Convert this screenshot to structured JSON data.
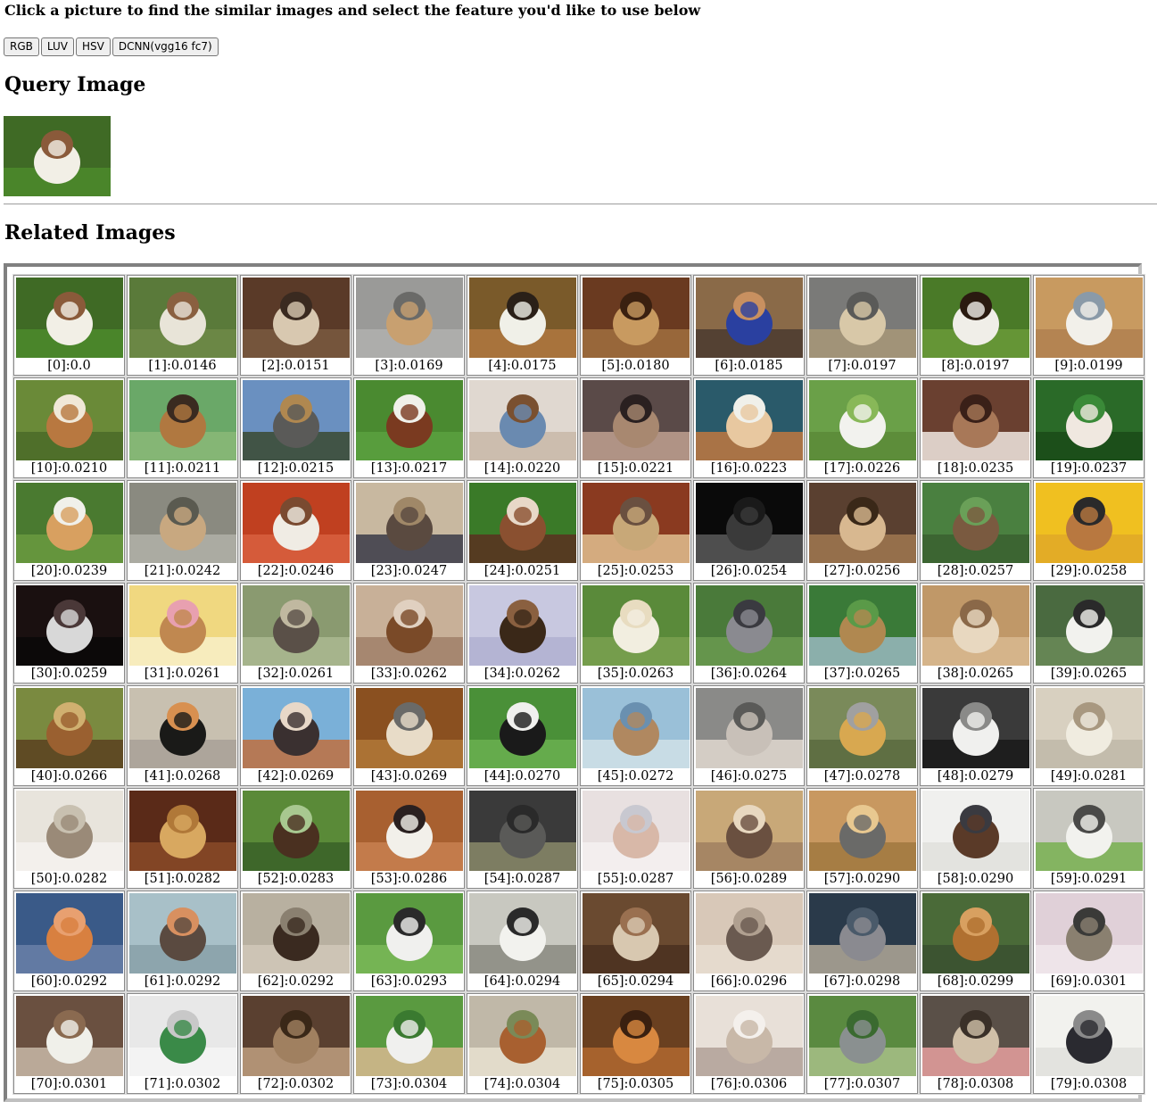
{
  "instructions": "Click a picture to find the similar images and select the feature you'd like to use below",
  "features": [
    "RGB",
    "LUV",
    "HSV",
    "DCNN(vgg16 fc7)"
  ],
  "query_heading": "Query Image",
  "related_heading": "Related Images",
  "query_image": {
    "colors": [
      "#3f6a25",
      "#f2efe6",
      "#8a5a3a",
      "#4c8a2c"
    ]
  },
  "results": [
    {
      "caption": "[0]:0.0",
      "colors": [
        "#3f6a25",
        "#f2efe6",
        "#8a5a3a",
        "#4c8a2c"
      ]
    },
    {
      "caption": "[1]:0.0146",
      "colors": [
        "#5a7a3a",
        "#e8e4d8",
        "#8a6040",
        "#6e8a48"
      ]
    },
    {
      "caption": "[2]:0.0151",
      "colors": [
        "#5a3a28",
        "#d8c8b0",
        "#3a2a20",
        "#7a5a40"
      ]
    },
    {
      "caption": "[3]:0.0169",
      "colors": [
        "#9a9a98",
        "#c8a070",
        "#6a6a68",
        "#b0b0ae"
      ]
    },
    {
      "caption": "[4]:0.0175",
      "colors": [
        "#7a5a2a",
        "#f0f0e8",
        "#2a2018",
        "#b07840"
      ]
    },
    {
      "caption": "[5]:0.0180",
      "colors": [
        "#6a3a20",
        "#c89a60",
        "#3a2010",
        "#a07040"
      ]
    },
    {
      "caption": "[6]:0.0185",
      "colors": [
        "#8a6a48",
        "#2a40a0",
        "#c89060",
        "#4a3a30"
      ]
    },
    {
      "caption": "[7]:0.0197",
      "colors": [
        "#7a7a78",
        "#d8c8a8",
        "#5a5a58",
        "#a89878"
      ]
    },
    {
      "caption": "[8]:0.0197",
      "colors": [
        "#4a7a28",
        "#f0eee8",
        "#2a1a10",
        "#6a9a38"
      ]
    },
    {
      "caption": "[9]:0.0199",
      "colors": [
        "#c89a60",
        "#f2f0ea",
        "#8a9aa8",
        "#b08050"
      ]
    },
    {
      "caption": "[10]:0.0210",
      "colors": [
        "#6a8a38",
        "#b87840",
        "#f0e8d8",
        "#4a6a28"
      ]
    },
    {
      "caption": "[11]:0.0211",
      "colors": [
        "#6aa868",
        "#b07840",
        "#3a2a20",
        "#8ab878"
      ]
    },
    {
      "caption": "[12]:0.0215",
      "colors": [
        "#6a90c0",
        "#5a5a58",
        "#b08850",
        "#3a4a30"
      ]
    },
    {
      "caption": "[13]:0.0217",
      "colors": [
        "#4a8a30",
        "#7a3a20",
        "#f0f0ea",
        "#5aa040"
      ]
    },
    {
      "caption": "[14]:0.0220",
      "colors": [
        "#e0d8d0",
        "#6a8ab0",
        "#7a5030",
        "#c8b8a8"
      ]
    },
    {
      "caption": "[15]:0.0221",
      "colors": [
        "#5a4a48",
        "#a88870",
        "#2a2020",
        "#c0a090"
      ]
    },
    {
      "caption": "[16]:0.0223",
      "colors": [
        "#2a5a6a",
        "#e8c8a0",
        "#f0f0ea",
        "#c07840"
      ]
    },
    {
      "caption": "[17]:0.0226",
      "colors": [
        "#6aa048",
        "#f2f2ee",
        "#88b858",
        "#5a8a38"
      ]
    },
    {
      "caption": "[18]:0.0235",
      "colors": [
        "#6a4030",
        "#a87858",
        "#3a2018",
        "#f0e8e0"
      ]
    },
    {
      "caption": "[19]:0.0237",
      "colors": [
        "#2a6a28",
        "#f0e8e0",
        "#3a8a38",
        "#1a4a18"
      ]
    },
    {
      "caption": "[20]:0.0239",
      "colors": [
        "#4a7a30",
        "#d8a060",
        "#f0f0ea",
        "#6a9a40"
      ]
    },
    {
      "caption": "[21]:0.0242",
      "colors": [
        "#8a8a80",
        "#c8a880",
        "#5a5a50",
        "#b0b0a8"
      ]
    },
    {
      "caption": "[22]:0.0246",
      "colors": [
        "#c04020",
        "#f0ece4",
        "#7a4a30",
        "#d86040"
      ]
    },
    {
      "caption": "[23]:0.0247",
      "colors": [
        "#c8b8a0",
        "#5a4a40",
        "#a08868",
        "#3a3a48"
      ]
    },
    {
      "caption": "[24]:0.0251",
      "colors": [
        "#3a7a28",
        "#8a5030",
        "#e8d8c8",
        "#5a3020"
      ]
    },
    {
      "caption": "[25]:0.0253",
      "colors": [
        "#8a3a20",
        "#c8a878",
        "#6a5040",
        "#e0c090"
      ]
    },
    {
      "caption": "[26]:0.0254",
      "colors": [
        "#0a0a0a",
        "#3a3a3a",
        "#1a1a1a",
        "#5a5a5a"
      ]
    },
    {
      "caption": "[27]:0.0256",
      "colors": [
        "#5a4030",
        "#d8b890",
        "#3a2818",
        "#a07850"
      ]
    },
    {
      "caption": "[28]:0.0257",
      "colors": [
        "#4a8040",
        "#7a5a40",
        "#6aa058",
        "#3a6030"
      ]
    },
    {
      "caption": "[29]:0.0258",
      "colors": [
        "#f0c020",
        "#b87840",
        "#2a2a2a",
        "#e0a828"
      ]
    },
    {
      "caption": "[30]:0.0259",
      "colors": [
        "#1a1010",
        "#d8d8d8",
        "#4a3838",
        "#0a0808"
      ]
    },
    {
      "caption": "[31]:0.0261",
      "colors": [
        "#f0d880",
        "#c08850",
        "#e8a0b0",
        "#f8f0c8"
      ]
    },
    {
      "caption": "[32]:0.0261",
      "colors": [
        "#8a9a70",
        "#5a5048",
        "#c0b8a0",
        "#aab890"
      ]
    },
    {
      "caption": "[33]:0.0262",
      "colors": [
        "#c8b098",
        "#7a4a28",
        "#e0d0c0",
        "#a08068"
      ]
    },
    {
      "caption": "[34]:0.0262",
      "colors": [
        "#c8c8e0",
        "#3a2818",
        "#8a6040",
        "#b0b0d0"
      ]
    },
    {
      "caption": "[35]:0.0263",
      "colors": [
        "#5a8a3a",
        "#f2eee0",
        "#e8dcc0",
        "#7aa050"
      ]
    },
    {
      "caption": "[36]:0.0264",
      "colors": [
        "#4a7a3a",
        "#8a8a90",
        "#3a3a40",
        "#6a9a50"
      ]
    },
    {
      "caption": "[37]:0.0265",
      "colors": [
        "#3a7a38",
        "#b08850",
        "#5a9a48",
        "#9ab8c0"
      ]
    },
    {
      "caption": "[38]:0.0265",
      "colors": [
        "#c09868",
        "#e8d8c0",
        "#8a6848",
        "#d8b890"
      ]
    },
    {
      "caption": "[39]:0.0265",
      "colors": [
        "#4a6a40",
        "#f2f2ee",
        "#2a2a2a",
        "#6a8a58"
      ]
    },
    {
      "caption": "[40]:0.0266",
      "colors": [
        "#7a8a40",
        "#9a6030",
        "#d0b070",
        "#5a4020"
      ]
    },
    {
      "caption": "[41]:0.0268",
      "colors": [
        "#c8c0b0",
        "#1a1a18",
        "#d89050",
        "#a8a098"
      ]
    },
    {
      "caption": "[42]:0.0269",
      "colors": [
        "#7ab0d8",
        "#3a3030",
        "#e8d8c8",
        "#c07040"
      ]
    },
    {
      "caption": "[43]:0.0269",
      "colors": [
        "#8a5020",
        "#e8dcc8",
        "#6a6a68",
        "#b07838"
      ]
    },
    {
      "caption": "[44]:0.0270",
      "colors": [
        "#4a9038",
        "#1a1a1a",
        "#f0f0ee",
        "#6ab050"
      ]
    },
    {
      "caption": "[45]:0.0272",
      "colors": [
        "#9ac0d8",
        "#b08860",
        "#6a90b0",
        "#d0e0e8"
      ]
    },
    {
      "caption": "[46]:0.0275",
      "colors": [
        "#8a8a88",
        "#c8c0b8",
        "#5a5a58",
        "#e0d8d0"
      ]
    },
    {
      "caption": "[47]:0.0278",
      "colors": [
        "#7a8a5a",
        "#d8a850",
        "#a0a0a0",
        "#5a6a40"
      ]
    },
    {
      "caption": "[48]:0.0279",
      "colors": [
        "#3a3a3a",
        "#f0f0ee",
        "#8a8a88",
        "#1a1a1a"
      ]
    },
    {
      "caption": "[49]:0.0281",
      "colors": [
        "#d8d0c0",
        "#f0ece0",
        "#a89880",
        "#c0b8a8"
      ]
    },
    {
      "caption": "[50]:0.0282",
      "colors": [
        "#e8e4dc",
        "#9a8a78",
        "#c8c0b0",
        "#f4f2ee"
      ]
    },
    {
      "caption": "[51]:0.0282",
      "colors": [
        "#5a2a18",
        "#d8a860",
        "#b07838",
        "#8a4a28"
      ]
    },
    {
      "caption": "[52]:0.0283",
      "colors": [
        "#5a8a38",
        "#4a3020",
        "#a8c890",
        "#3a6028"
      ]
    },
    {
      "caption": "[53]:0.0286",
      "colors": [
        "#a86030",
        "#f2f0ea",
        "#2a2020",
        "#c88050"
      ]
    },
    {
      "caption": "[54]:0.0287",
      "colors": [
        "#3a3a3a",
        "#5a5a58",
        "#2a2a2a",
        "#8a8a6a"
      ]
    },
    {
      "caption": "[55]:0.0287",
      "colors": [
        "#e8e0e0",
        "#d8b8a8",
        "#c8c8d0",
        "#f4f0f0"
      ]
    },
    {
      "caption": "[56]:0.0289",
      "colors": [
        "#c8a878",
        "#6a5040",
        "#e8d8c0",
        "#a08060"
      ]
    },
    {
      "caption": "[57]:0.0290",
      "colors": [
        "#c89860",
        "#6a6a68",
        "#e8c890",
        "#a07840"
      ]
    },
    {
      "caption": "[58]:0.0290",
      "colors": [
        "#f0f0ee",
        "#5a3a28",
        "#3a3a40",
        "#e0e0dc"
      ]
    },
    {
      "caption": "[59]:0.0291",
      "colors": [
        "#c8c8c0",
        "#f2f2ee",
        "#4a4a48",
        "#78b050"
      ]
    },
    {
      "caption": "[60]:0.0292",
      "colors": [
        "#3a5a88",
        "#d88040",
        "#e8a070",
        "#6a80a8"
      ]
    },
    {
      "caption": "[61]:0.0292",
      "colors": [
        "#a8c0c8",
        "#5a4a40",
        "#d89060",
        "#88a0a8"
      ]
    },
    {
      "caption": "[62]:0.0292",
      "colors": [
        "#b8b0a0",
        "#3a2a20",
        "#8a8070",
        "#d0c8b8"
      ]
    },
    {
      "caption": "[63]:0.0293",
      "colors": [
        "#5a9a40",
        "#f0f0ee",
        "#2a2a2a",
        "#7ab858"
      ]
    },
    {
      "caption": "[64]:0.0294",
      "colors": [
        "#c8c8c0",
        "#f2f2ee",
        "#2a2a2a",
        "#8a8a80"
      ]
    },
    {
      "caption": "[65]:0.0294",
      "colors": [
        "#6a4a30",
        "#d8c8b0",
        "#9a7050",
        "#4a3020"
      ]
    },
    {
      "caption": "[66]:0.0296",
      "colors": [
        "#d8c8b8",
        "#6a5a50",
        "#b0a090",
        "#e8ddd0"
      ]
    },
    {
      "caption": "[67]:0.0298",
      "colors": [
        "#2a3a4a",
        "#8a8a90",
        "#4a5a6a",
        "#b0a898"
      ]
    },
    {
      "caption": "[68]:0.0299",
      "colors": [
        "#4a6a38",
        "#b07030",
        "#d8a060",
        "#3a5030"
      ]
    },
    {
      "caption": "[69]:0.0301",
      "colors": [
        "#e0d0d8",
        "#8a8070",
        "#3a3a38",
        "#f0e8ec"
      ]
    },
    {
      "caption": "[70]:0.0301",
      "colors": [
        "#6a5040",
        "#f0f0ea",
        "#8a6a50",
        "#c8b8a8"
      ]
    },
    {
      "caption": "[71]:0.0302",
      "colors": [
        "#e8e8e8",
        "#3a8a48",
        "#c8c8c8",
        "#f4f4f4"
      ]
    },
    {
      "caption": "[72]:0.0302",
      "colors": [
        "#5a4030",
        "#a08060",
        "#3a2818",
        "#c0a080"
      ]
    },
    {
      "caption": "[73]:0.0304",
      "colors": [
        "#5a9a40",
        "#f0f0ee",
        "#3a7a30",
        "#d8b890"
      ]
    },
    {
      "caption": "[74]:0.0304",
      "colors": [
        "#c0b8a8",
        "#a86030",
        "#7a8a58",
        "#e8e0d0"
      ]
    },
    {
      "caption": "[75]:0.0305",
      "colors": [
        "#6a4020",
        "#d88840",
        "#3a2010",
        "#b06830"
      ]
    },
    {
      "caption": "[76]:0.0306",
      "colors": [
        "#e8e0d8",
        "#c8b8a8",
        "#f4f0ec",
        "#b0a098"
      ]
    },
    {
      "caption": "[77]:0.0307",
      "colors": [
        "#5a8a40",
        "#8a9090",
        "#3a6a30",
        "#a8c088"
      ]
    },
    {
      "caption": "[78]:0.0308",
      "colors": [
        "#5a5048",
        "#d0c0a8",
        "#3a3028",
        "#e8a0a0"
      ]
    },
    {
      "caption": "[79]:0.0308",
      "colors": [
        "#f2f2ee",
        "#2a2a30",
        "#8a8a8a",
        "#e0e0dc"
      ]
    }
  ]
}
